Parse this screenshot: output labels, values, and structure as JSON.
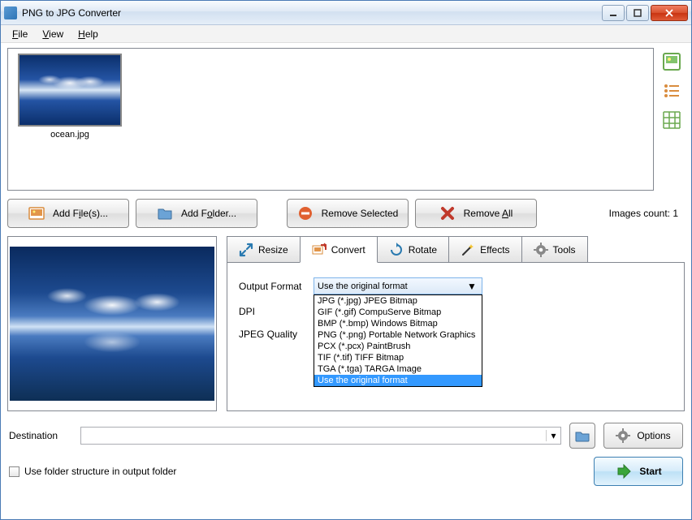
{
  "window": {
    "title": "PNG to JPG Converter"
  },
  "menu": {
    "file": "File",
    "view": "View",
    "help": "Help"
  },
  "thumb": {
    "label": "ocean.jpg"
  },
  "toolbar": {
    "add_files": "Add File(s)...",
    "add_folder": "Add Folder...",
    "remove_selected": "Remove Selected",
    "remove_all": "Remove All"
  },
  "images_count_label": "Images count: 1",
  "tabs": {
    "resize": "Resize",
    "convert": "Convert",
    "rotate": "Rotate",
    "effects": "Effects",
    "tools": "Tools"
  },
  "convert": {
    "output_format_label": "Output Format",
    "dpi_label": "DPI",
    "jpeg_quality_label": "JPEG Quality",
    "selected_value": "Use the original format",
    "options": [
      "JPG (*.jpg) JPEG Bitmap",
      "GIF (*.gif) CompuServe Bitmap",
      "BMP (*.bmp) Windows Bitmap",
      "PNG (*.png) Portable Network Graphics",
      "PCX (*.pcx) PaintBrush",
      "TIF (*.tif) TIFF Bitmap",
      "TGA (*.tga) TARGA Image",
      "Use the original format"
    ]
  },
  "destination": {
    "label": "Destination",
    "value": ""
  },
  "options_label": "Options",
  "folder_structure_label": "Use folder structure in output folder",
  "start_label": "Start"
}
